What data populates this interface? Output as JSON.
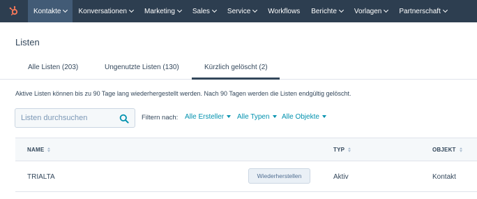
{
  "nav": {
    "items": [
      {
        "label": "Kontakte",
        "active": true
      },
      {
        "label": "Konversationen",
        "active": false
      },
      {
        "label": "Marketing",
        "active": false
      },
      {
        "label": "Sales",
        "active": false
      },
      {
        "label": "Service",
        "active": false
      },
      {
        "label": "Workflows",
        "active": false
      },
      {
        "label": "Berichte",
        "active": false
      },
      {
        "label": "Vorlagen",
        "active": false
      },
      {
        "label": "Partnerschaft",
        "active": false
      }
    ],
    "logo_icon": "hubspot-sprocket-icon",
    "bg_color": "#2d3e50",
    "logo_color": "#ff7a59"
  },
  "page_title": "Listen",
  "tabs": [
    {
      "label": "Alle Listen (203)",
      "active": false
    },
    {
      "label": "Ungenutzte Listen (130)",
      "active": false
    },
    {
      "label": "Kürzlich gelöscht (2)",
      "active": true
    }
  ],
  "info_text": "Aktive Listen können bis zu 90 Tage lang wiederhergestellt werden. Nach 90 Tagen werden die Listen endgültig gelöscht.",
  "search": {
    "placeholder": "Listen durchsuchen",
    "value": ""
  },
  "filters": {
    "label": "Filtern nach:",
    "items": [
      "Alle Ersteller",
      "Alle Typen",
      "Alle Objekte"
    ]
  },
  "table": {
    "columns": [
      "NAME",
      "TYP",
      "OBJEKT"
    ],
    "rows": [
      {
        "name": "TRIALTA",
        "action": "Wiederherstellen",
        "type": "Aktiv",
        "object": "Kontakt"
      }
    ]
  },
  "colors": {
    "link": "#0091ae",
    "text": "#33475b"
  }
}
